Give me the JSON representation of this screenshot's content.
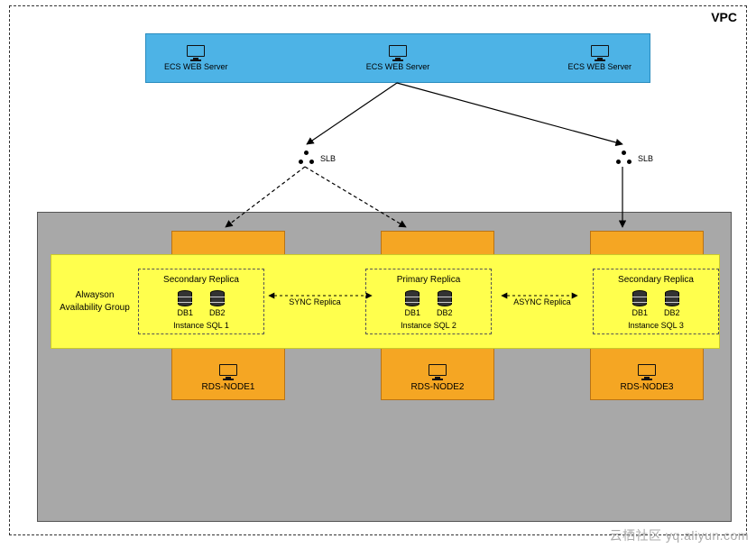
{
  "vpc_label": "VPC",
  "ecs": {
    "server1": "ECS WEB Server",
    "server2": "ECS WEB Server",
    "server3": "ECS WEB Server"
  },
  "slb": {
    "label1": "SLB",
    "label2": "SLB"
  },
  "group": {
    "title_line1": "Alwayson",
    "title_line2": "Availability Group",
    "link_left": "SYNC Replica",
    "link_right": "ASYNC Replica",
    "replica1": {
      "title": "Secondary Replica",
      "db1": "DB1",
      "db2": "DB2",
      "instance": "Instance SQL 1"
    },
    "replica2": {
      "title": "Primary Replica",
      "db1": "DB1",
      "db2": "DB2",
      "instance": "Instance SQL 2"
    },
    "replica3": {
      "title": "Secondary Replica",
      "db1": "DB1",
      "db2": "DB2",
      "instance": "Instance SQL 3"
    }
  },
  "rds": {
    "node1": "RDS-NODE1",
    "node2": "RDS-NODE2",
    "node3": "RDS-NODE3"
  },
  "watermark": "云栖社区 yq.aliyun.com"
}
